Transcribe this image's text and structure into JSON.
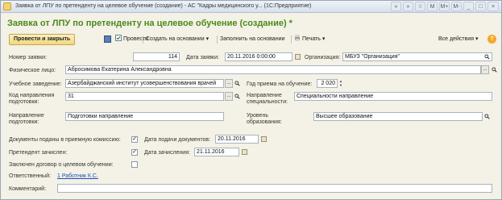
{
  "window": {
    "title": "Заявка от ЛПУ по претенденту на целевое обучение (создание) - АС \"Кадры медицинского у... (1С:Предприятие)",
    "controls": [
      "«",
      "»",
      "☆",
      "M",
      "M+",
      "M-",
      "_",
      "□",
      "×"
    ]
  },
  "form": {
    "title": "Заявка от ЛПУ по претенденту на целевое обучение (создание) *"
  },
  "toolbar": {
    "post_close": "Провести и закрыть",
    "post": "Провести",
    "create_based": "Создать на основании",
    "fill_based": "Заполнить на основании",
    "print": "Печать",
    "all_actions": "Все действия",
    "help": "?"
  },
  "fields": {
    "number_label": "Номер заявки:",
    "number_value": "114",
    "date_label": "Дата заявки:",
    "date_value": "20.11.2016  0:00:00",
    "org_label": "Организация:",
    "org_value": "МБУЗ \"Организация\"",
    "person_label": "Физическое лицо:",
    "person_value": "Абросимова Екатерина Александровна",
    "school_label": "Учебное заведение:",
    "school_value": "Азербайджанский институт усовершенствования врачей",
    "year_label": "Год приема на обучение:",
    "year_value": "2 020",
    "prep_code_label_1": "Код направления",
    "prep_code_label_2": "подготовки:",
    "prep_code_value": "31",
    "spec_dir_label_1": "Направление",
    "spec_dir_label_2": "специальности:",
    "spec_dir_value": "Специальности направление",
    "prep_dir_label_1": "Направление",
    "prep_dir_label_2": "подготовки:",
    "prep_dir_value": "Подготовки направление",
    "edu_level_label_1": "Уровень",
    "edu_level_label_2": "образования:",
    "edu_level_value": "Высшее образование",
    "docs_label": "Документы поданы в приемную комиссию:",
    "docs_date_label": "Дата подачи документов:",
    "docs_date_value": "20.11.2016",
    "enrolled_label": "Претендент зачислен:",
    "enrolled_date_label": "Дата зачисления:",
    "enrolled_date_value": "21.11.2016",
    "contract_label": "Заключен договор о целевом обучении:",
    "responsible_label": "Ответственный:",
    "responsible_value": "1 Работник К.С.",
    "comment_label": "Комментарий:",
    "comment_value": ""
  },
  "colors": {
    "title_green": "#4a8a1c",
    "primary_button": "#f1d87c",
    "link": "#1a4fb8"
  }
}
